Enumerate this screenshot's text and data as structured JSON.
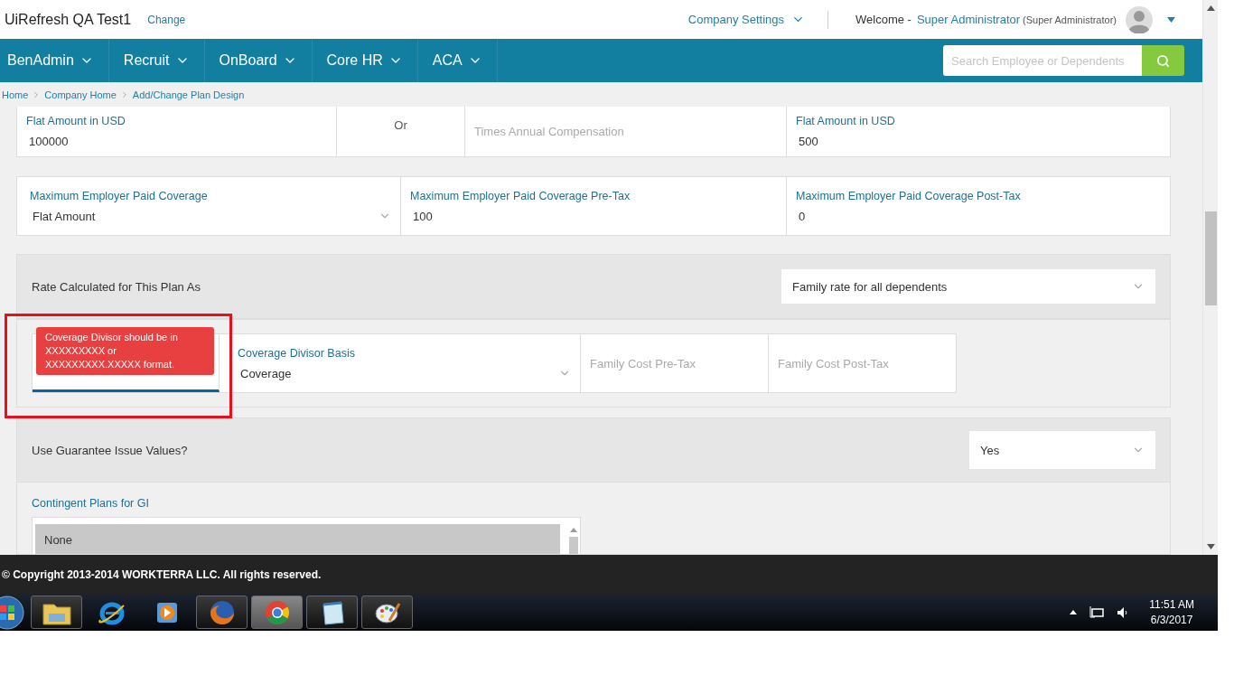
{
  "header": {
    "company": "UiRefresh QA Test1",
    "change_link": "Change",
    "settings_menu": "Company Settings",
    "welcome": "Welcome -",
    "user_name": "Super Administrator",
    "user_role": "(Super Administrator)"
  },
  "nav": {
    "items": [
      {
        "label": "BenAdmin"
      },
      {
        "label": "Recruit"
      },
      {
        "label": "OnBoard"
      },
      {
        "label": "Core HR"
      },
      {
        "label": "ACA"
      }
    ],
    "search": {
      "placeholder": "Search Employee or Dependents"
    }
  },
  "breadcrumb": [
    "Home",
    "Company Home",
    "Add/Change Plan Design"
  ],
  "coverage_row": [
    {
      "kind": "input",
      "label": "Flat Amount in USD",
      "value": "100000"
    },
    {
      "kind": "text",
      "value": "Or"
    },
    {
      "kind": "input",
      "placeholder": "Times Annual Compensation"
    },
    {
      "kind": "input",
      "label": "Flat Amount in USD",
      "value": "500"
    }
  ],
  "employer_row": [
    {
      "kind": "select",
      "label": "Maximum Employer Paid Coverage",
      "value": "Flat Amount"
    },
    {
      "kind": "input",
      "label": "Maximum Employer Paid Coverage Pre-Tax",
      "value": "100"
    },
    {
      "kind": "input",
      "label": "Maximum Employer Paid Coverage Post-Tax",
      "value": "0"
    }
  ],
  "rate_panel": {
    "label": "Rate Calculated for This Plan As",
    "value": "Family rate for all dependents"
  },
  "divisor_row": [
    {
      "kind": "input",
      "focused": true,
      "error": "Coverage Divisor should be in XXXXXXXXX or XXXXXXXXX.XXXXX format."
    },
    {
      "kind": "select",
      "label": "Coverage Divisor Basis",
      "value": "Coverage"
    },
    {
      "kind": "input",
      "placeholder": "Family Cost Pre-Tax"
    },
    {
      "kind": "input",
      "placeholder": "Family Cost Post-Tax"
    }
  ],
  "gi_panel": {
    "label": "Use Guarantee Issue Values?",
    "value": "Yes"
  },
  "contingent": {
    "label": "Contingent Plans for GI",
    "items": [
      {
        "label": "None",
        "selected": true
      }
    ]
  },
  "footer": "© Copyright 2013-2014 WORKTERRA LLC. All rights reserved.",
  "taskbar": {
    "apps": [
      {
        "kind": "folder",
        "open": true,
        "selected": false
      },
      {
        "kind": "ie",
        "open": false,
        "selected": false
      },
      {
        "kind": "media",
        "open": false,
        "selected": false
      },
      {
        "kind": "firefox",
        "open": true,
        "selected": false
      },
      {
        "kind": "chrome",
        "open": true,
        "selected": true
      },
      {
        "kind": "notepad",
        "open": true,
        "selected": false
      },
      {
        "kind": "paint",
        "open": true,
        "selected": false
      }
    ],
    "time": "11:51 AM",
    "date": "6/3/2017"
  }
}
